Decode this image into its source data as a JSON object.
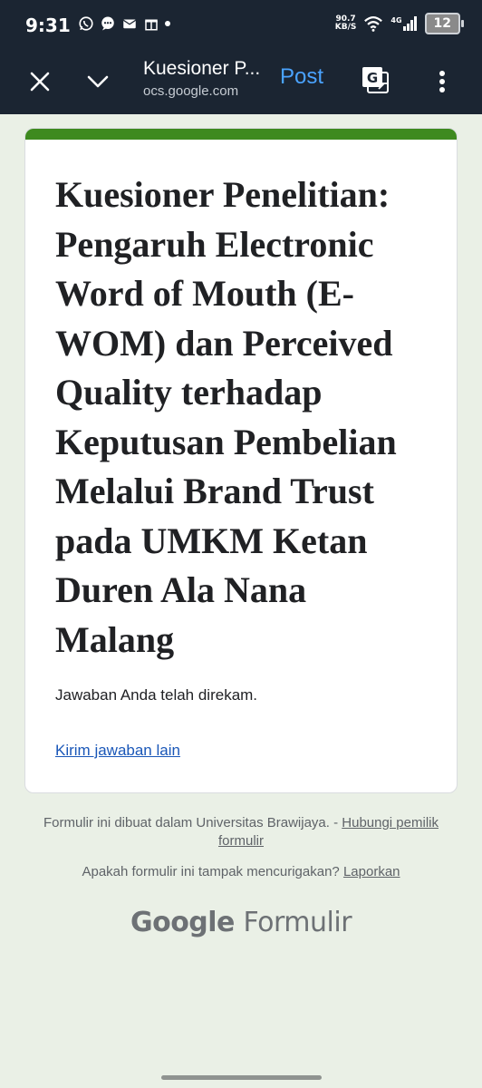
{
  "status_bar": {
    "time": "9:31",
    "net_speed_value": "90.7",
    "net_speed_unit": "KB/S",
    "network": "4G",
    "battery": "12"
  },
  "toolbar": {
    "title": "Kuesioner P...",
    "url": "ocs.google.com",
    "post_label": "Post"
  },
  "form": {
    "title": "Kuesioner Penelitian: Pengaruh Electronic Word of Mouth (E-WOM) dan Perceived Quality terhadap Keputusan Pembelian Melalui Brand Trust pada UMKM Ketan Duren Ala Nana Malang",
    "confirmation": "Jawaban Anda telah direkam.",
    "submit_another": "Kirim jawaban lain",
    "accent_color": "#3e8a1f"
  },
  "footer": {
    "created_text": "Formulir ini dibuat dalam Universitas Brawijaya. - ",
    "contact_owner": "Hubungi pemilik formulir",
    "suspicious_text": "Apakah formulir ini tampak mencurigakan? ",
    "report": "Laporkan",
    "brand_google": "Google",
    "brand_product": "Formulir"
  }
}
